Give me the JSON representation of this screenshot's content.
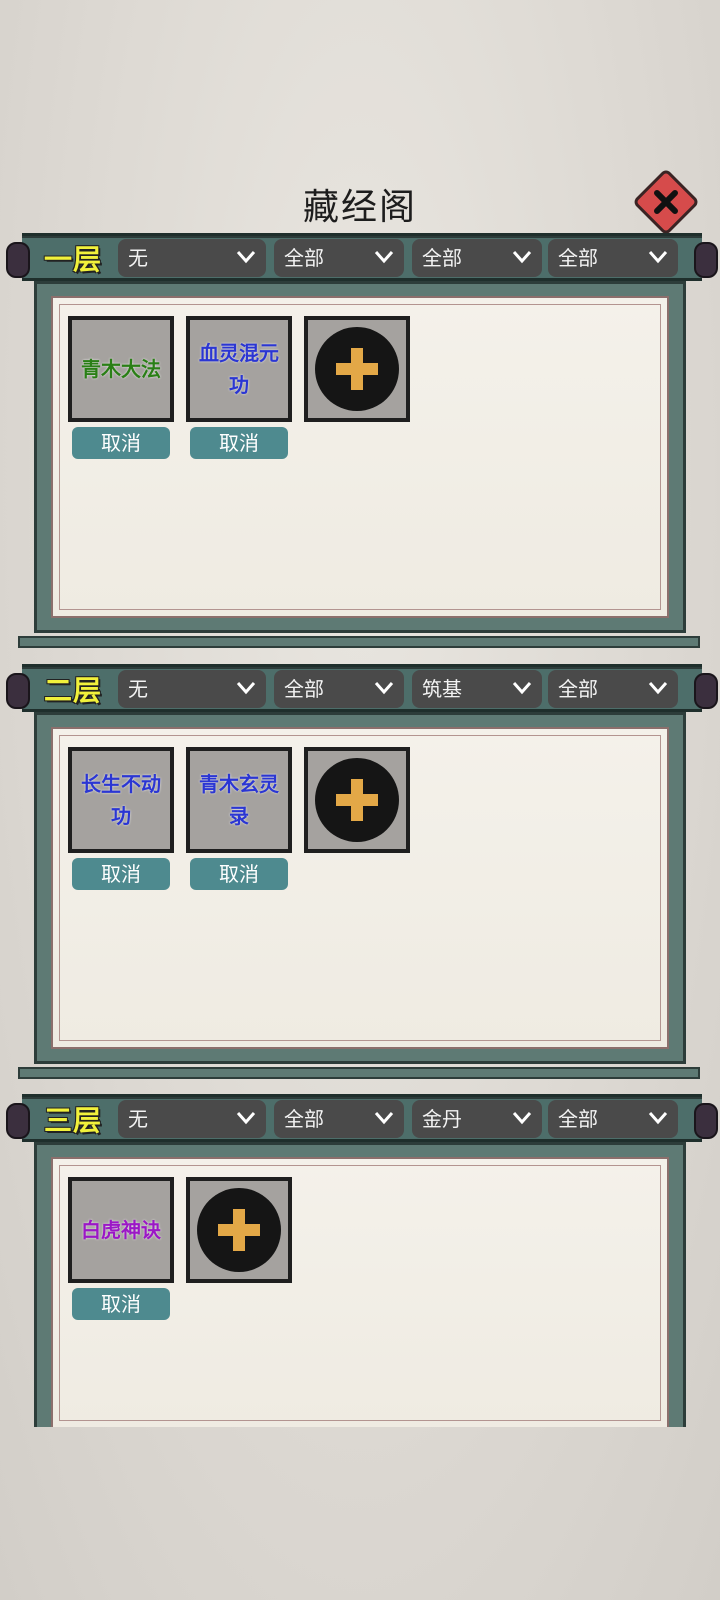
{
  "header": {
    "title": "藏经阁"
  },
  "floors": [
    {
      "label": "一层",
      "filters": [
        "无",
        "全部",
        "全部",
        "全部"
      ],
      "books": [
        {
          "name": "青木大法",
          "color": "#2a7f16",
          "cancel": "取消"
        },
        {
          "name": "血灵混元功",
          "color": "#2b36d3",
          "cancel": "取消"
        }
      ]
    },
    {
      "label": "二层",
      "filters": [
        "无",
        "全部",
        "筑基",
        "全部"
      ],
      "books": [
        {
          "name": "长生不动功",
          "color": "#2b36d3",
          "cancel": "取消"
        },
        {
          "name": "青木玄灵录",
          "color": "#2b36d3",
          "cancel": "取消"
        }
      ]
    },
    {
      "label": "三层",
      "filters": [
        "无",
        "全部",
        "金丹",
        "全部"
      ],
      "books": [
        {
          "name": "白虎神诀",
          "color": "#9b17c6",
          "cancel": "取消"
        }
      ]
    }
  ],
  "icons": {
    "close": "close-icon",
    "add": "plus-icon",
    "dropdown": "chevron-down-icon"
  }
}
